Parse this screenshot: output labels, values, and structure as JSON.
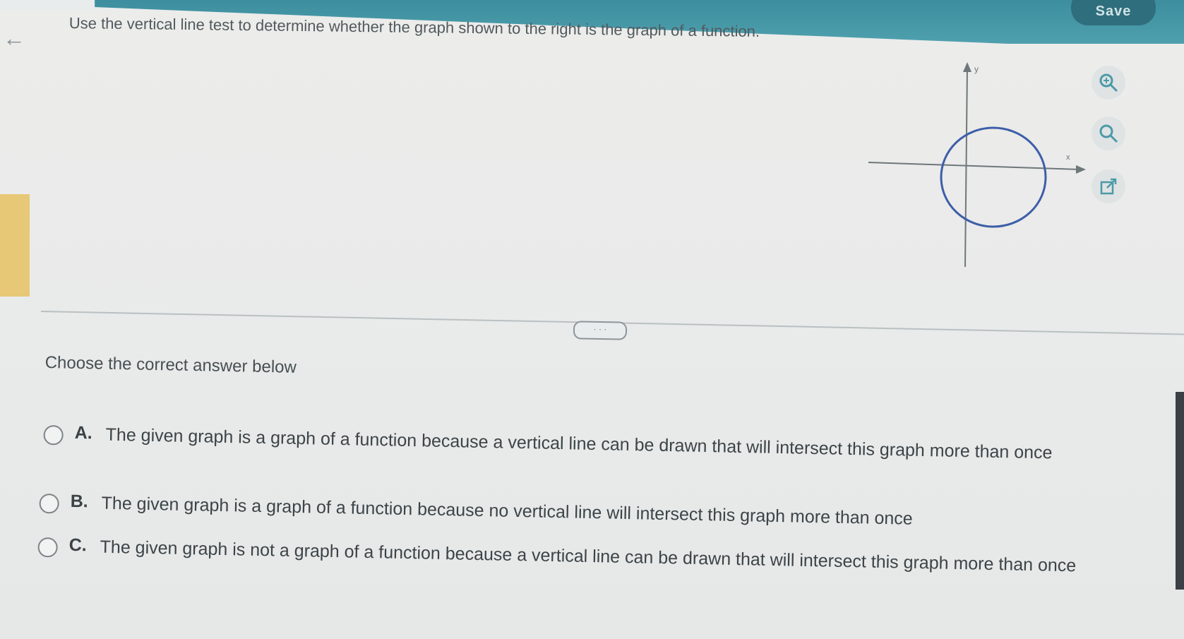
{
  "header": {
    "save_label": "Save"
  },
  "question": {
    "text": "Use the vertical line test to determine whether the graph shown to the right is the graph of a function."
  },
  "graph": {
    "x_axis_label": "x",
    "y_axis_label": "y",
    "curve": "circle",
    "curve_color": "#3d5ea8"
  },
  "tools": {
    "zoom_in": "zoom-in-icon",
    "zoom_out": "zoom-out-icon",
    "popout": "popout-icon"
  },
  "more_label": "· · ·",
  "prompt": "Choose the correct answer below",
  "choices": [
    {
      "letter": "A.",
      "text": "The given graph is a graph of a function because a vertical line can be drawn that will intersect this graph more than once"
    },
    {
      "letter": "B.",
      "text": "The given graph is a graph of a function because no vertical line will intersect this graph more than once"
    },
    {
      "letter": "C.",
      "text": "The given graph is not a graph of a function because a vertical line can be drawn that will intersect this graph more than once"
    }
  ],
  "colors": {
    "header": "#4fa0ae",
    "accent": "#e7c876",
    "background": "#e9ecec"
  }
}
